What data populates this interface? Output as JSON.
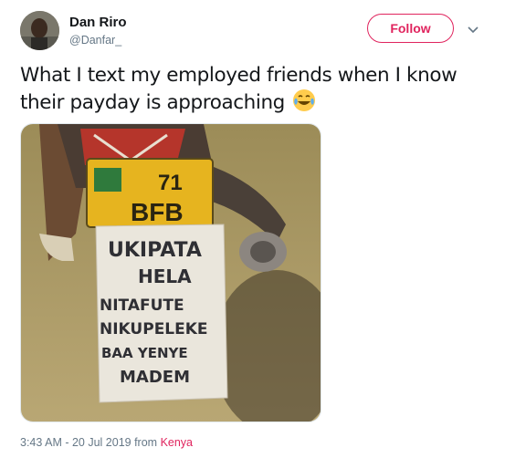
{
  "user": {
    "name": "Dan Riro",
    "handle": "@Danfar_",
    "avatar": "avatar-photo"
  },
  "follow_label": "Follow",
  "icons": {
    "caret": "chevron-down-icon",
    "emoji": "face-with-tears-of-joy-icon"
  },
  "tweet": {
    "text": "What I text my employed friends when I know their payday is approaching"
  },
  "photo": {
    "plate_number_top": "71",
    "plate_number_bottom": "BFB",
    "sign_lines": [
      "UKIPATA",
      "HELA",
      "NITAFUTE",
      "NIKUPELEKE",
      "BAA YENYE",
      "MADEM"
    ]
  },
  "meta": {
    "timestamp": "3:43 AM - 20 Jul 2019 from ",
    "location": "Kenya"
  },
  "colors": {
    "accent": "#e0245e",
    "secondary_text": "#657786"
  }
}
